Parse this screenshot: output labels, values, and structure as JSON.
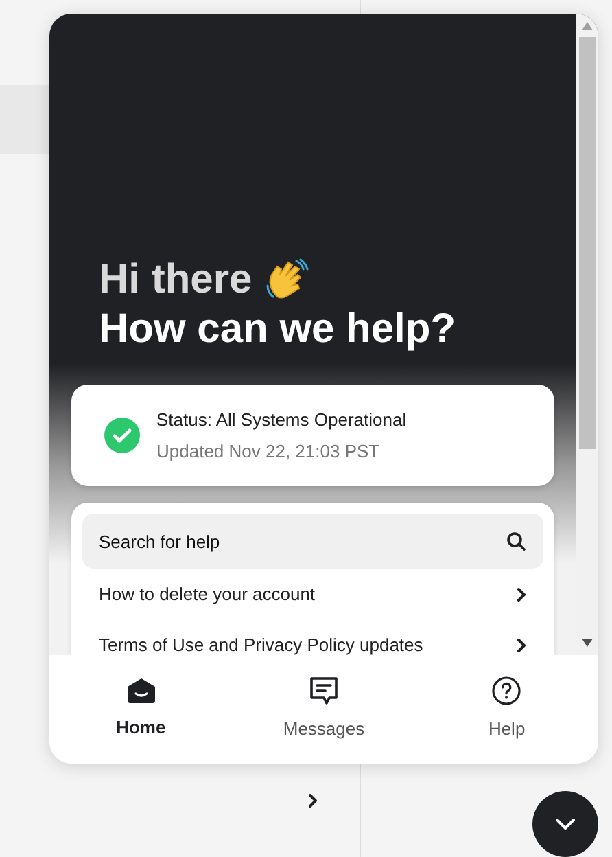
{
  "greeting": "Hi there",
  "headline": "How can we help?",
  "status": {
    "title": "Status: All Systems Operational",
    "updated": "Updated Nov 22, 21:03 PST",
    "ok": true
  },
  "search": {
    "placeholder": "Search for help"
  },
  "articles": [
    {
      "title": "How to delete your account"
    },
    {
      "title": "Terms of Use and Privacy Policy updates"
    }
  ],
  "nav": [
    {
      "label": "Home",
      "kind": "home",
      "selected": true
    },
    {
      "label": "Messages",
      "kind": "messages",
      "selected": false
    },
    {
      "label": "Help",
      "kind": "help",
      "selected": false
    }
  ]
}
